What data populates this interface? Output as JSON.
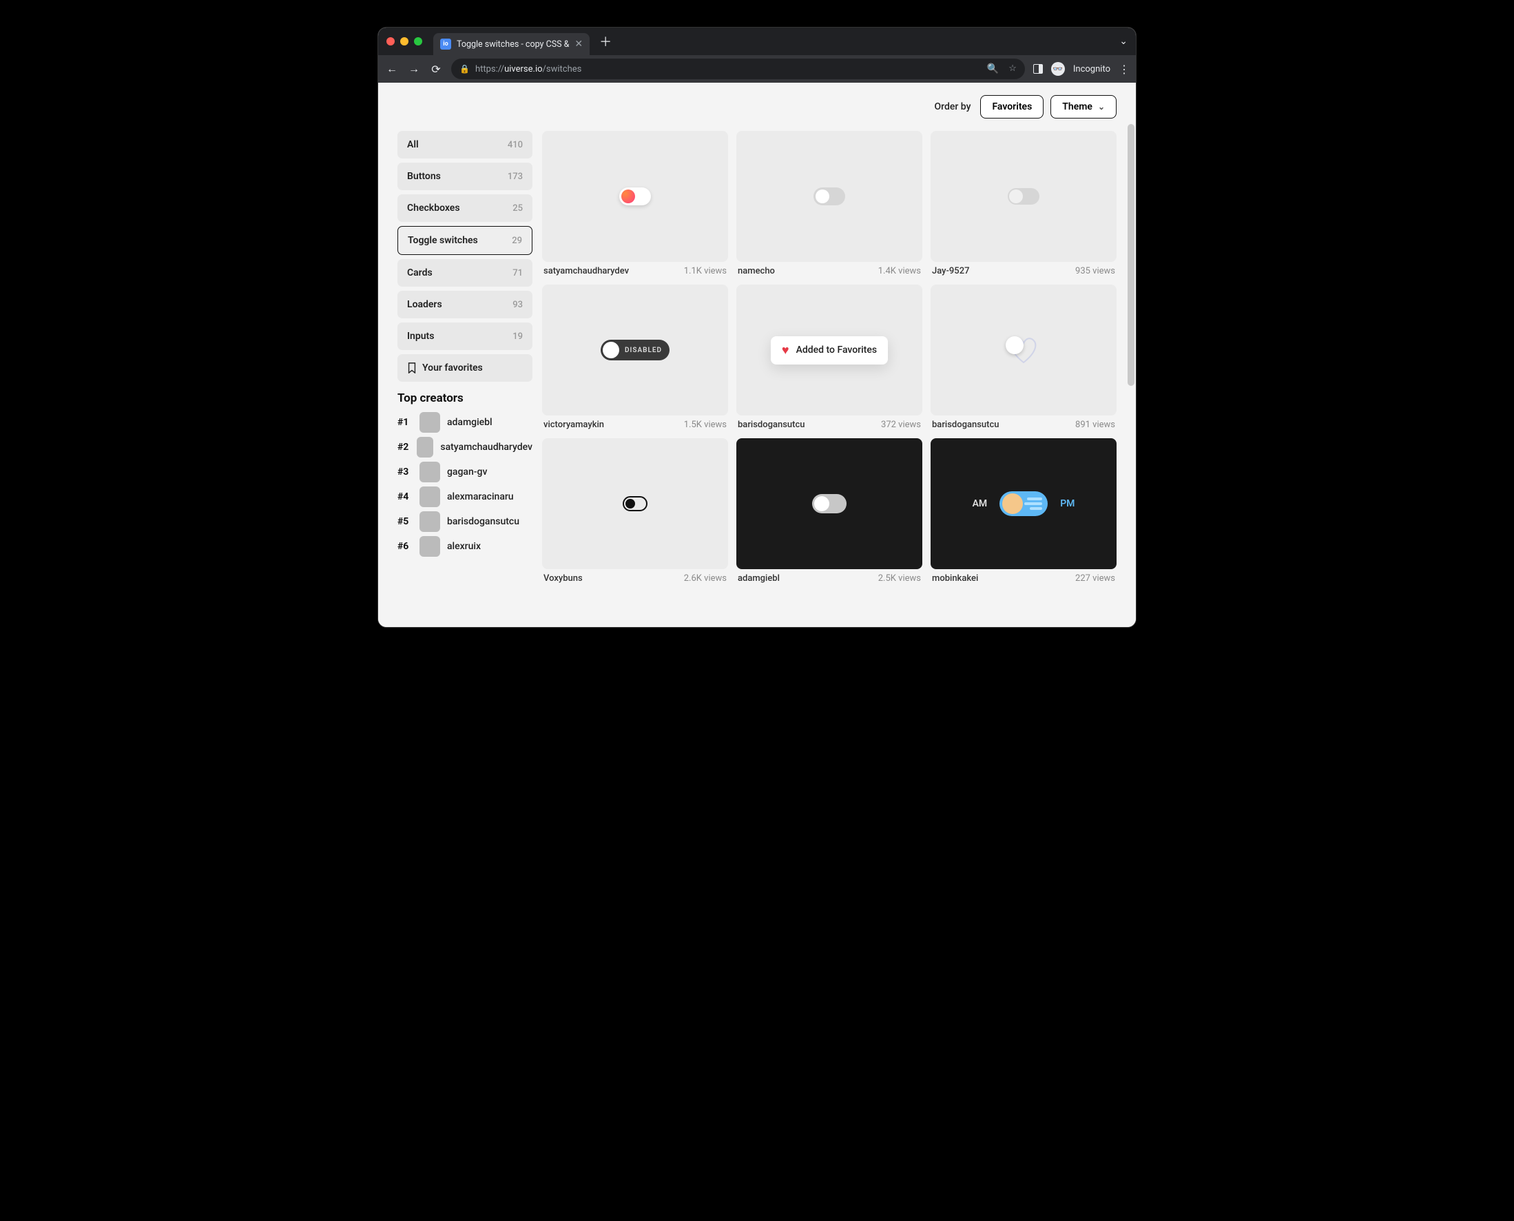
{
  "browser": {
    "tab_title": "Toggle switches - copy CSS &",
    "url_scheme": "https://",
    "url_host": "uiverse.io",
    "url_path": "/switches",
    "incognito_label": "Incognito"
  },
  "orderbar": {
    "label": "Order by",
    "sort_button": "Favorites",
    "theme_button": "Theme"
  },
  "categories": [
    {
      "label": "All",
      "count": "410"
    },
    {
      "label": "Buttons",
      "count": "173"
    },
    {
      "label": "Checkboxes",
      "count": "25"
    },
    {
      "label": "Toggle switches",
      "count": "29",
      "active": true
    },
    {
      "label": "Cards",
      "count": "71"
    },
    {
      "label": "Loaders",
      "count": "93"
    },
    {
      "label": "Inputs",
      "count": "19"
    }
  ],
  "favorites_label": "Your favorites",
  "top_creators_heading": "Top creators",
  "creators": [
    {
      "rank": "#1",
      "name": "adamgiebl"
    },
    {
      "rank": "#2",
      "name": "satyamchaudharydev"
    },
    {
      "rank": "#3",
      "name": "gagan-gv"
    },
    {
      "rank": "#4",
      "name": "alexmaracinaru"
    },
    {
      "rank": "#5",
      "name": "barisdogansutcu"
    },
    {
      "rank": "#6",
      "name": "alexruix"
    }
  ],
  "cards": [
    {
      "author": "satyamchaudharydev",
      "views": "1.1K views"
    },
    {
      "author": "namecho",
      "views": "1.4K views"
    },
    {
      "author": "Jay-9527",
      "views": "935 views"
    },
    {
      "author": "victoryamaykin",
      "views": "1.5K views",
      "disabled_label": "DISABLED"
    },
    {
      "author": "barisdogansutcu",
      "views": "372 views",
      "toast": "Added to Favorites"
    },
    {
      "author": "barisdogansutcu",
      "views": "891 views"
    },
    {
      "author": "Voxybuns",
      "views": "2.6K views"
    },
    {
      "author": "adamgiebl",
      "views": "2.5K views"
    },
    {
      "author": "mobinkakei",
      "views": "227 views",
      "am": "AM",
      "pm": "PM"
    }
  ]
}
